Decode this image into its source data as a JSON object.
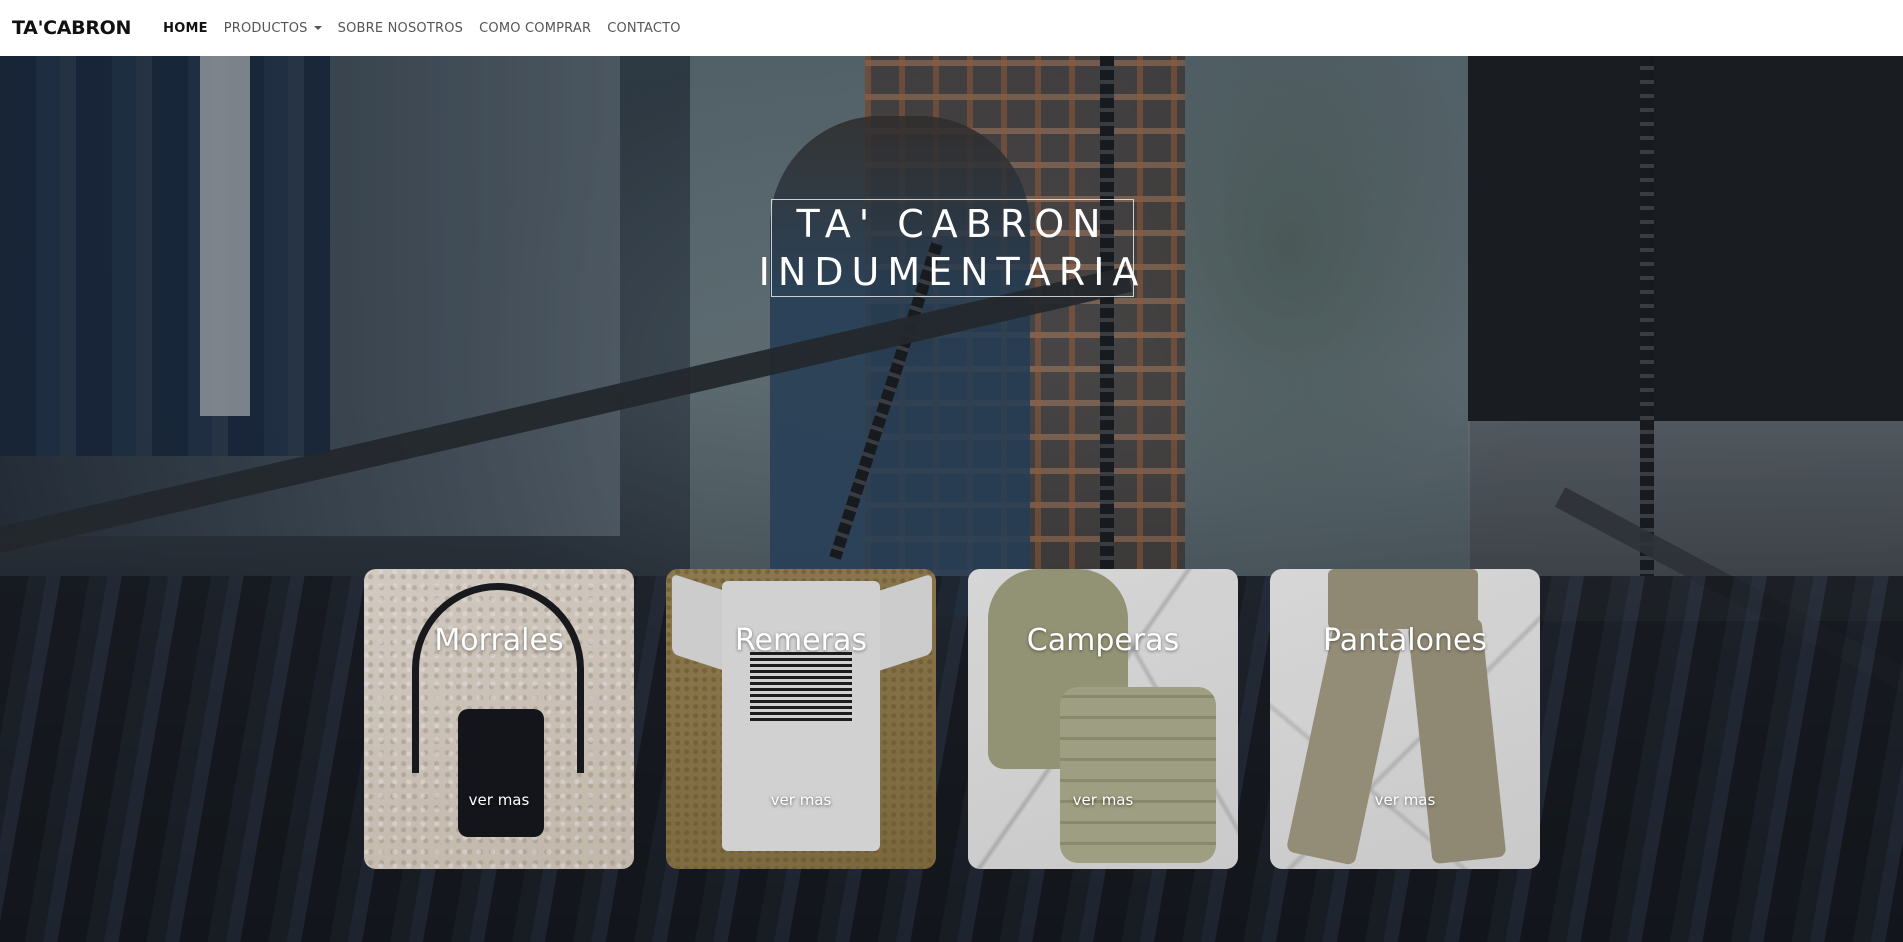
{
  "navbar": {
    "brand": "TA'CABRON",
    "links": [
      {
        "label": "HOME",
        "active": true
      },
      {
        "label": "PRODUCTOS",
        "dropdown": true
      },
      {
        "label": "SOBRE NOSOTROS"
      },
      {
        "label": "COMO COMPRAR"
      },
      {
        "label": "CONTACTO"
      }
    ]
  },
  "hero": {
    "title_line1": "TA' CABRON",
    "title_line2": "INDUMENTARIA"
  },
  "cards": [
    {
      "title": "Morrales",
      "link": "ver mas"
    },
    {
      "title": "Remeras",
      "link": "ver mas"
    },
    {
      "title": "Camperas",
      "link": "ver mas"
    },
    {
      "title": "Pantalones",
      "link": "ver mas"
    }
  ],
  "icons": {
    "dropdown": "chevron-down-icon"
  },
  "colors": {
    "navbar_bg": "#ffffff",
    "nav_active": "#111111",
    "nav_text": "#555555",
    "hero_text": "#ffffff"
  }
}
